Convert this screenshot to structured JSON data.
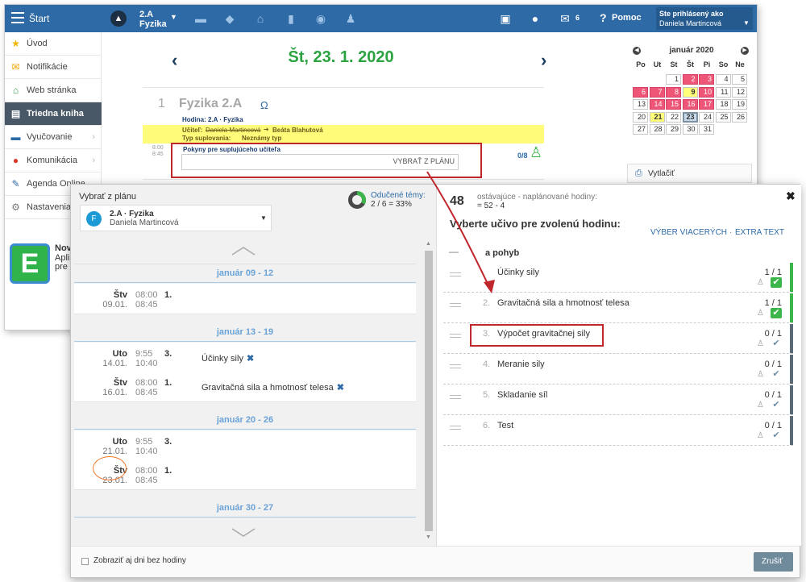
{
  "topbar": {
    "menu_label": "Štart",
    "class_name": "2.A",
    "subject": "Fyzika",
    "messages_count": "6",
    "help_label": "Pomoc",
    "login_label": "Ste prihlásený ako",
    "user_name": "Daniela Martincová"
  },
  "sidebar": {
    "items": [
      {
        "label": "Úvod"
      },
      {
        "label": "Notifikácie"
      },
      {
        "label": "Web stránka"
      },
      {
        "label": "Triedna kniha"
      },
      {
        "label": "Vyučovanie"
      },
      {
        "label": "Komunikácia"
      },
      {
        "label": "Agenda Online"
      },
      {
        "label": "Nastavenia"
      }
    ],
    "promo_title": "Novi",
    "promo_line1": "Aplik",
    "promo_line2": "pre n"
  },
  "day": {
    "date": "Št, 23. 1. 2020",
    "lesson_number": "1",
    "lesson_title": "Fyzika 2.A",
    "hodina_label": "Hodina:",
    "hodina_value": "2.A · Fyzika",
    "ucitel_label": "Učiteľ:",
    "ucitel_old": "Daniela Martincová",
    "ucitel_new": "Beáta Blahutová",
    "typ_label": "Typ suplovania:",
    "typ_value": "Neznámy typ",
    "time_start": "8:00",
    "time_end": "8:45",
    "pokyny_label": "Pokyny pre suplujúceho učiteľa",
    "vybrat_label": "VYBRAŤ Z PLÁNU",
    "attendance": "0/8"
  },
  "calendar": {
    "month_label": "január 2020",
    "weekdays": [
      "Po",
      "Ut",
      "St",
      "Št",
      "Pi",
      "So",
      "Ne"
    ],
    "days": [
      [
        {
          "d": "",
          "s": ""
        },
        {
          "d": "",
          "s": ""
        },
        {
          "d": "1",
          "s": ""
        },
        {
          "d": "2",
          "s": "red"
        },
        {
          "d": "3",
          "s": "red"
        },
        {
          "d": "4",
          "s": ""
        },
        {
          "d": "5",
          "s": ""
        }
      ],
      [
        {
          "d": "6",
          "s": "red"
        },
        {
          "d": "7",
          "s": "red"
        },
        {
          "d": "8",
          "s": "red"
        },
        {
          "d": "9",
          "s": "yel"
        },
        {
          "d": "10",
          "s": "red"
        },
        {
          "d": "11",
          "s": ""
        },
        {
          "d": "12",
          "s": ""
        }
      ],
      [
        {
          "d": "13",
          "s": ""
        },
        {
          "d": "14",
          "s": "red"
        },
        {
          "d": "15",
          "s": "red"
        },
        {
          "d": "16",
          "s": "red"
        },
        {
          "d": "17",
          "s": "red"
        },
        {
          "d": "18",
          "s": ""
        },
        {
          "d": "19",
          "s": ""
        }
      ],
      [
        {
          "d": "20",
          "s": ""
        },
        {
          "d": "21",
          "s": "yel"
        },
        {
          "d": "22",
          "s": ""
        },
        {
          "d": "23",
          "s": "today"
        },
        {
          "d": "24",
          "s": ""
        },
        {
          "d": "25",
          "s": ""
        },
        {
          "d": "26",
          "s": ""
        }
      ],
      [
        {
          "d": "27",
          "s": ""
        },
        {
          "d": "28",
          "s": ""
        },
        {
          "d": "29",
          "s": ""
        },
        {
          "d": "30",
          "s": ""
        },
        {
          "d": "31",
          "s": ""
        },
        {
          "d": "",
          "s": ""
        },
        {
          "d": "",
          "s": ""
        }
      ]
    ],
    "print_label": "Vytlačiť"
  },
  "modal": {
    "left_title": "Vybrať z plánu",
    "plan_avatar": "F",
    "plan_name": "2.A · Fyzika",
    "plan_teacher": "Daniela Martincová",
    "progress_label": "Odučené témy:",
    "progress_value": "2 / 6 = 33%",
    "progress_fraction": 0.33,
    "weeks": [
      {
        "label": "január 09 - 12",
        "days": [
          {
            "day": "Štv",
            "date": "09.01.",
            "t1": "08:00",
            "t2": "08:45",
            "lesson": "1.",
            "topic": "",
            "topic_x": ""
          }
        ]
      },
      {
        "label": "január 13 - 19",
        "days": [
          {
            "day": "Uto",
            "date": "14.01.",
            "t1": "9:55",
            "t2": "10:40",
            "lesson": "3.",
            "topic": "Účinky sily",
            "topic_x": "✖"
          },
          {
            "day": "Štv",
            "date": "16.01.",
            "t1": "08:00",
            "t2": "08:45",
            "lesson": "1.",
            "topic": "Gravitačná sila a hmotnosť telesa",
            "topic_x": "✖"
          }
        ]
      },
      {
        "label": "január 20 - 26",
        "days": [
          {
            "day": "Uto",
            "date": "21.01.",
            "t1": "9:55",
            "t2": "10:40",
            "lesson": "3.",
            "topic": "",
            "topic_x": ""
          },
          {
            "day": "Štv",
            "date": "23.01.",
            "t1": "08:00",
            "t2": "08:45",
            "lesson": "1.",
            "topic": "",
            "topic_x": ""
          }
        ]
      },
      {
        "label": "január 30 - 27",
        "days": []
      }
    ],
    "remaining_count": "48",
    "remaining_label": "ostávajúce - naplánované hodiny:",
    "remaining_formula": "= 52 - 4",
    "choose_title": "Vyberte učivo pre zvolenú hodinu:",
    "multi_link": "VÝBER VIACERÝCH",
    "extra_link": "EXTRA TEXT",
    "group_name": "a pohyb",
    "topics": [
      {
        "num": "",
        "name": "Účinky sily",
        "count": "1 / 1",
        "done": true
      },
      {
        "num": "2.",
        "name": "Gravitačná sila a hmotnosť telesa",
        "count": "1 / 1",
        "done": true
      },
      {
        "num": "3.",
        "name": "Výpočet gravitačnej sily",
        "count": "0 / 1",
        "done": false
      },
      {
        "num": "4.",
        "name": "Meranie sily",
        "count": "0 / 1",
        "done": false
      },
      {
        "num": "5.",
        "name": "Skladanie síl",
        "count": "0 / 1",
        "done": false
      },
      {
        "num": "6.",
        "name": "Test",
        "count": "0 / 1",
        "done": false
      }
    ],
    "show_days_label": "Zobraziť aj dni bez hodiny",
    "cancel_label": "Zrušiť"
  },
  "colors": {
    "topbar": "#2e6ba6",
    "accent_green": "#3cb54a",
    "highlight_red": "#c0272d",
    "orange_circle": "#ee7a2e"
  }
}
